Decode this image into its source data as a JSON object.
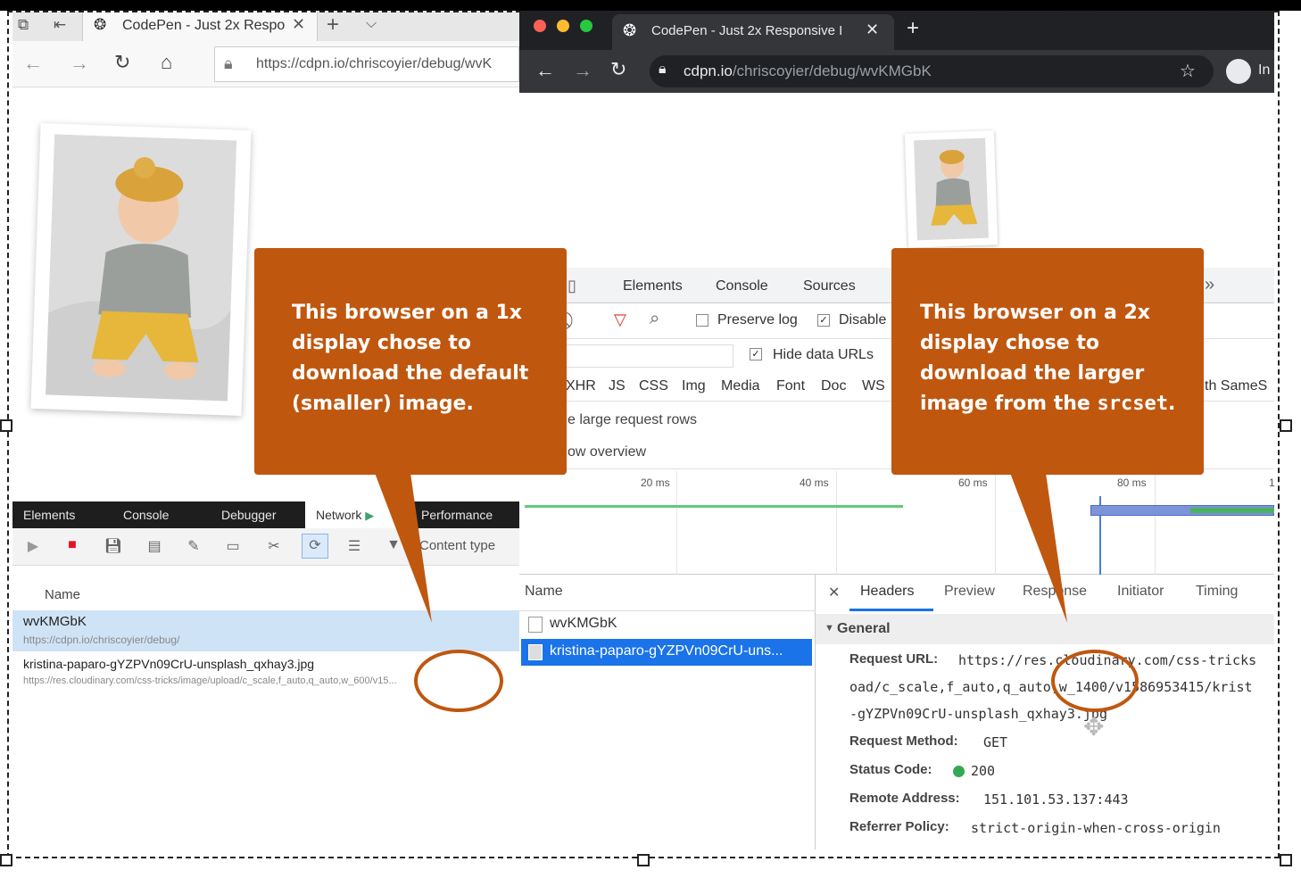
{
  "left_browser": {
    "tab_title": "CodePen - Just 2x Respo",
    "url": "https://cdpn.io/chriscoyier/debug/wvK",
    "devtools": {
      "tabs": [
        "Elements",
        "Console",
        "Debugger",
        "Network",
        "Performance"
      ],
      "filter_placeholder": "Content type",
      "column_name": "Name",
      "rows": [
        {
          "name": "wvKMGbK",
          "url": "https://cdpn.io/chriscoyier/debug/"
        },
        {
          "name": "kristina-paparo-gYZPVn09CrU-unsplash_qxhay3.jpg",
          "url": "https://res.cloudinary.com/css-tricks/image/upload/c_scale,f_auto,q_auto,w_600/v15..."
        }
      ]
    }
  },
  "right_browser": {
    "tab_title": "CodePen - Just 2x Responsive I",
    "url_host": "cdpn.io",
    "url_path": "/chriscoyier/debug/wvKMGbK",
    "profile_label": "In",
    "devtools": {
      "tabs": [
        "Elements",
        "Console",
        "Sources"
      ],
      "more": "»",
      "preserve_log": "Preserve log",
      "disable_cache": "Disable",
      "hide_data_urls": "Hide data URLs",
      "types": [
        "XHR",
        "JS",
        "CSS",
        "Img",
        "Media",
        "Font",
        "Doc",
        "WS"
      ],
      "samesite": "th SameS",
      "opt1": "e large request rows",
      "opt2": "ow overview",
      "timeline_ticks": [
        "20 ms",
        "40 ms",
        "60 ms",
        "80 ms",
        "1"
      ],
      "name_header": "Name",
      "requests": [
        "wvKMGbK",
        "kristina-paparo-gYZPVn09CrU-uns..."
      ],
      "detail_tabs": [
        "Headers",
        "Preview",
        "Response",
        "Initiator",
        "Timing"
      ],
      "general_label": "General",
      "request_url_label": "Request URL:",
      "request_url_line1": "https://res.cloudinary.com/css-tricks",
      "request_url_line2": "oad/c_scale,f_auto,q_auto,w_1400/v1586953415/krist",
      "request_url_line3": "-gYZPVn09CrU-unsplash_qxhay3.jpg",
      "method_label": "Request Method:",
      "method_value": "GET",
      "status_label": "Status Code:",
      "status_value": "200",
      "remote_label": "Remote Address:",
      "remote_value": "151.101.53.137:443",
      "referrer_label": "Referrer Policy:",
      "referrer_value": "strict-origin-when-cross-origin"
    }
  },
  "callouts": {
    "left": "This browser on a 1x display chose to download the default (smaller) image.",
    "right_prefix": "This browser on a 2x display chose to download the larger image from the ",
    "right_code": "srcset",
    "right_suffix": "."
  },
  "colors": {
    "callout": "#c0570f",
    "chrome_dark": "#202124",
    "selection": "#1a73e8"
  }
}
